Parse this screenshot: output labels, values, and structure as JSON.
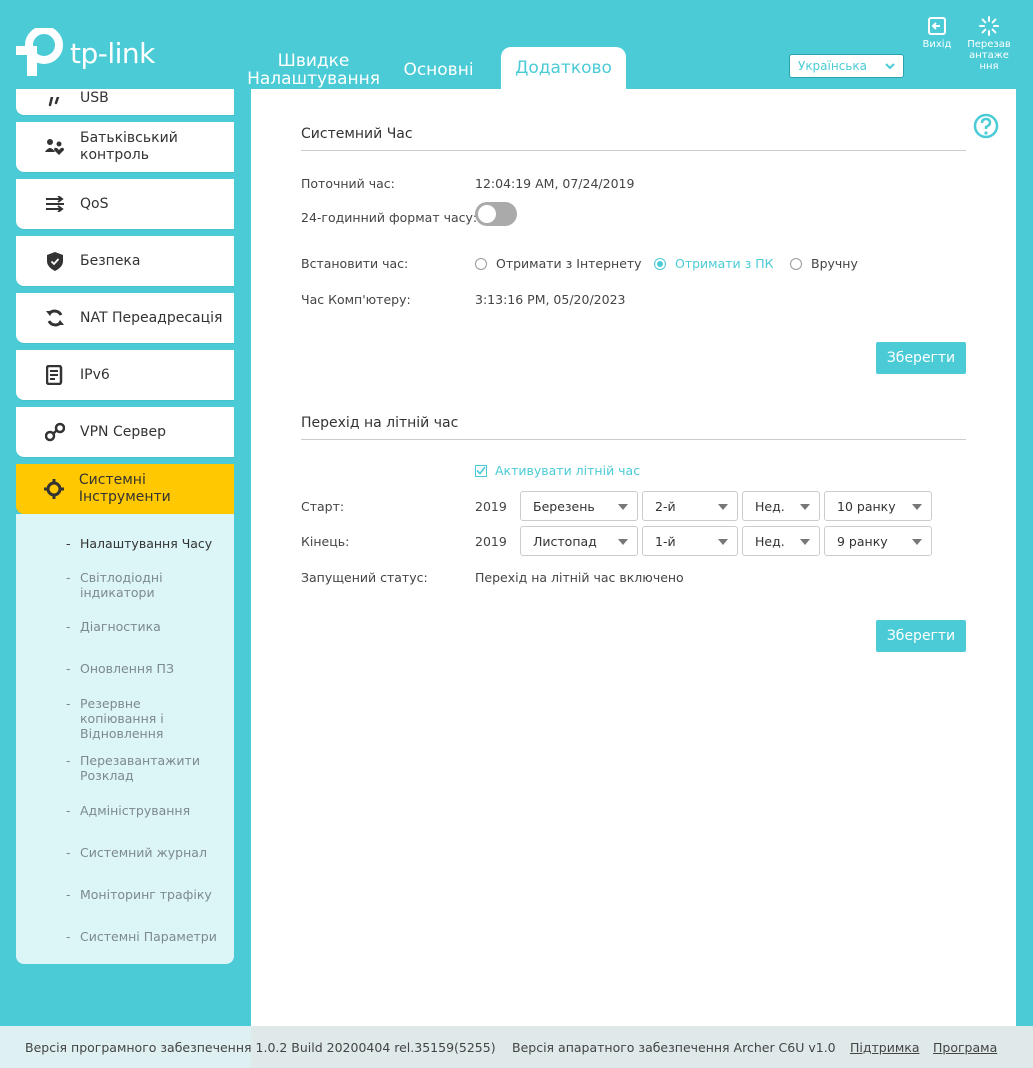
{
  "header": {
    "logo_text": "tp-link",
    "tabs": [
      {
        "label": "Швидке Налаштування"
      },
      {
        "label": "Основні"
      },
      {
        "label": "Додатково"
      }
    ],
    "language": "Українська",
    "exit_label": "Вихід",
    "reboot_label": "Перезавантаження"
  },
  "sidebar": {
    "items": [
      {
        "label": "USB"
      },
      {
        "label": "Батьківський контроль"
      },
      {
        "label": "QoS"
      },
      {
        "label": "Безпека"
      },
      {
        "label": "NAT Переадресація"
      },
      {
        "label": "IPv6"
      },
      {
        "label": "VPN Сервер"
      },
      {
        "label": "Системні Інструменти"
      }
    ],
    "submenu": [
      {
        "label": "Налаштування Часу"
      },
      {
        "label": "Світлодіодні індикатори"
      },
      {
        "label": "Діагностика"
      },
      {
        "label": "Оновлення ПЗ"
      },
      {
        "label": "Резервне копіювання і Відновлення"
      },
      {
        "label": "Перезавантажити Розклад"
      },
      {
        "label": "Адміністрування"
      },
      {
        "label": "Системний журнал"
      },
      {
        "label": "Моніторинг трафіку"
      },
      {
        "label": "Системні Параметри"
      }
    ]
  },
  "system_time": {
    "title": "Системний Час",
    "current_time_label": "Поточний час:",
    "current_time_value": "12:04:19 AM, 07/24/2019",
    "format24_label": "24-годинний формат часу:",
    "set_time_label": "Встановити час:",
    "option_internet": "Отримати з Інтернету",
    "option_pc": "Отримати з ПК",
    "option_manual": "Вручну",
    "pc_time_label": "Час Комп'ютеру:",
    "pc_time_value": "3:13:16 PM, 05/20/2023",
    "save_label": "Зберегти"
  },
  "dst": {
    "title": "Перехід на літній час",
    "enable_label": "Активувати літній час",
    "start_label": "Старт:",
    "start_year": "2019",
    "start_month": "Березень",
    "start_week": "2-й",
    "start_day": "Нед.",
    "start_hour": "10 ранку",
    "end_label": "Кінець:",
    "end_year": "2019",
    "end_month": "Листопад",
    "end_week": "1-й",
    "end_day": "Нед.",
    "end_hour": "9 ранку",
    "status_label": "Запущений статус:",
    "status_value": "Перехід на літній час включено",
    "save_label": "Зберегти"
  },
  "footer": {
    "firmware": "Версія програмного забезпечення 1.0.2 Build 20200404 rel.35159(5255)",
    "hardware": "Версія апаратного забезпечення Archer C6U v1.0",
    "support": "Підтримка",
    "app": "Програма"
  }
}
